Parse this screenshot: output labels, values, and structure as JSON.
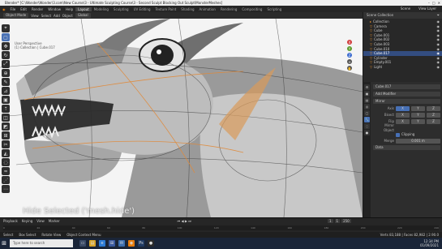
{
  "window": {
    "title": "Blender* [C:\\Wonder\\Wonder\\3.com\\New Course\\3 - Ultimate Sculpting Course\\3 - Second Sculpt Blocking Out Sculpt\\MonsterMeshes]"
  },
  "menubar": {
    "menus": [
      "File",
      "Edit",
      "Render",
      "Window",
      "Help"
    ],
    "workspaces": [
      "Layout",
      "Modeling",
      "Sculpting",
      "UV Editing",
      "Texture Paint",
      "Shading",
      "Animation",
      "Rendering",
      "Compositing",
      "Scripting"
    ],
    "active_workspace": "Layout",
    "scene": "Scene",
    "view_layer": "View Layer"
  },
  "viewport_header": {
    "mode": "Object Mode",
    "items": [
      "View",
      "Select",
      "Add",
      "Object"
    ],
    "orientation": "Global"
  },
  "viewport": {
    "overlay_info": [
      "User Perspective",
      "(1) Collection | Cube.017"
    ],
    "operator_hint": "Hide Selected ('mesh.hide')"
  },
  "toolbar": {
    "tools": [
      "cursor-icon",
      "select-icon",
      "move-icon",
      "rotate-icon",
      "scale-icon",
      "transform-icon",
      "annotate-icon",
      "measure-icon",
      "add-cube-icon",
      "extrude-icon",
      "inset-icon",
      "bevel-icon",
      "loopcut-icon",
      "knife-icon",
      "polybuild-icon",
      "spin-icon",
      "smooth-icon",
      "shear-icon",
      "rip-icon"
    ],
    "glyphs": [
      "⌖",
      "▢",
      "✥",
      "↻",
      "⤢",
      "⊕",
      "✎",
      "⊿",
      "▣",
      "⇡",
      "◫",
      "◩",
      "⊞",
      "✂",
      "◭",
      "◌",
      "≈",
      "⋰",
      "⋯"
    ],
    "active_index": 1
  },
  "outliner": {
    "header": "Scene Collection",
    "rows": [
      {
        "label": "Collection",
        "selected": false
      },
      {
        "label": "Camera",
        "selected": false
      },
      {
        "label": "Cube",
        "selected": false
      },
      {
        "label": "Cube.001",
        "selected": false
      },
      {
        "label": "Cube.002",
        "selected": false
      },
      {
        "label": "Cube.003",
        "selected": false
      },
      {
        "label": "Cube.010",
        "selected": false
      },
      {
        "label": "Cube.017",
        "selected": true
      },
      {
        "label": "Cylinder",
        "selected": false
      },
      {
        "label": "Empty.001",
        "selected": false
      },
      {
        "label": "Light",
        "selected": false
      }
    ]
  },
  "properties": {
    "object_name": "Cube.017",
    "modifier_button": "Add Modifier",
    "modifier_name": "Mirror",
    "rows": [
      {
        "label": "Axis",
        "values": [
          "X",
          "Y",
          "Z"
        ]
      },
      {
        "label": "Bisect",
        "values": [
          "X",
          "Y",
          "Z"
        ]
      },
      {
        "label": "Flip",
        "values": [
          "X",
          "Y",
          "Z"
        ]
      }
    ],
    "mirror_object_label": "Mirror Object",
    "clipping_label": "Clipping",
    "merge_label": "Merge",
    "merge_value": "0.001 m",
    "data_label": "Data"
  },
  "timeline": {
    "menus": [
      "Playback",
      "Keying",
      "View",
      "Marker"
    ],
    "ticks": [
      "0",
      "20",
      "40",
      "60",
      "80",
      "100",
      "120",
      "140",
      "160",
      "180",
      "200",
      "220",
      "240"
    ],
    "current_frame": "1",
    "start": "1",
    "end": "250"
  },
  "statusbar": {
    "items": [
      "Select",
      "Box Select",
      "Rotate View",
      "Object Context Menu"
    ],
    "version": "Verts 83,188 | Faces 82,982 | 2.90.0"
  },
  "taskbar": {
    "search_placeholder": "Type here to search",
    "apps": [
      "task-view-icon",
      "file-explorer-icon",
      "edge-icon",
      "store-icon",
      "mail-icon",
      "blender-icon",
      "photoshop-icon",
      "obs-icon"
    ],
    "app_glyphs": [
      "▭",
      "▤",
      "e",
      "⊞",
      "✉",
      "◉",
      "Ps",
      "●"
    ],
    "app_colors": [
      "#3a4a66",
      "#d9a62a",
      "#2c7bd6",
      "#3a5aa0",
      "#3d6fb0",
      "#e87d0d",
      "#1f3a63",
      "#2b2b2b"
    ],
    "time": "12:34 PM",
    "date": "01/09/2021"
  }
}
